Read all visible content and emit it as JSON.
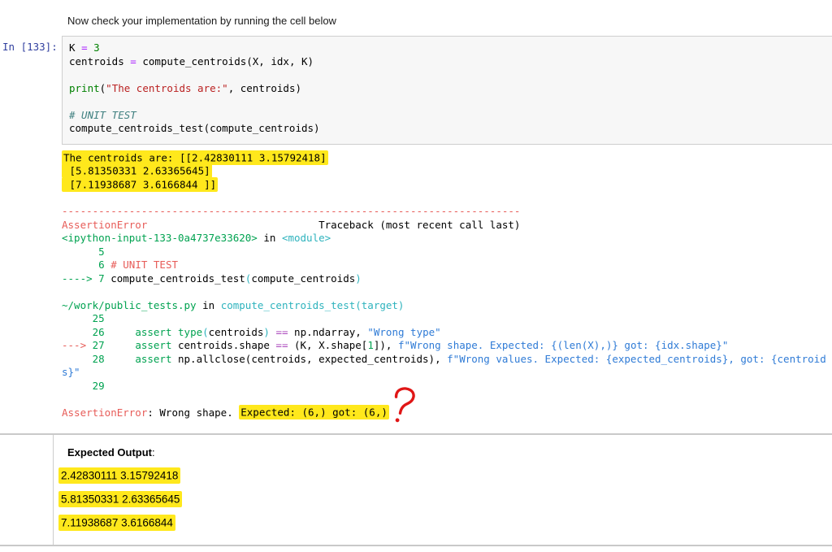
{
  "page": {
    "intro_text": "Now check your implementation by running the cell below"
  },
  "cell": {
    "prompt": "In [133]:",
    "code_lines": [
      {
        "segments": [
          {
            "t": "K "
          },
          {
            "t": "=",
            "c": "op"
          },
          {
            "t": " "
          },
          {
            "t": "3",
            "c": "num"
          }
        ]
      },
      {
        "segments": [
          {
            "t": "centroids "
          },
          {
            "t": "=",
            "c": "op"
          },
          {
            "t": " compute_centroids(X, idx, K)"
          }
        ]
      },
      {
        "segments": []
      },
      {
        "segments": [
          {
            "t": "print",
            "c": "bi"
          },
          {
            "t": "("
          },
          {
            "t": "\"The centroids are:\"",
            "c": "str"
          },
          {
            "t": ", centroids)"
          }
        ]
      },
      {
        "segments": []
      },
      {
        "segments": [
          {
            "t": "# UNIT TEST",
            "c": "cm"
          }
        ]
      },
      {
        "segments": [
          {
            "t": "compute_centroids_test(compute_centroids)"
          }
        ]
      }
    ]
  },
  "output": {
    "stdout_lines": [
      {
        "segments": [
          {
            "t": "The centroids are: [[2.42830111 3.15792418]",
            "h": true
          }
        ]
      },
      {
        "segments": [
          {
            "t": " [5.81350331 2.63365645]",
            "h": true
          }
        ]
      },
      {
        "segments": [
          {
            "t": " [7.11938687 3.6166844 ]]",
            "h": true
          }
        ]
      }
    ],
    "traceback_lines": [
      {
        "segments": [
          {
            "t": "---------------------------------------------------------------------------",
            "c": "r"
          }
        ]
      },
      {
        "segments": [
          {
            "t": "AssertionError",
            "c": "r"
          },
          {
            "t": "                            Traceback (most recent call last)"
          }
        ]
      },
      {
        "segments": [
          {
            "t": "<ipython-input-133-0a4737e33620>",
            "c": "g"
          },
          {
            "t": " in "
          },
          {
            "t": "<module>",
            "c": "cy"
          }
        ]
      },
      {
        "segments": [
          {
            "t": "      5 ",
            "c": "g"
          }
        ]
      },
      {
        "segments": [
          {
            "t": "      6 ",
            "c": "g"
          },
          {
            "t": "# UNIT TEST",
            "c": "r"
          }
        ]
      },
      {
        "segments": [
          {
            "t": "----> 7 ",
            "c": "g"
          },
          {
            "t": "compute_centroids_test"
          },
          {
            "t": "(",
            "c": "cy"
          },
          {
            "t": "compute_centroids"
          },
          {
            "t": ")",
            "c": "cy"
          }
        ]
      },
      {
        "segments": []
      },
      {
        "segments": [
          {
            "t": "~/work/public_tests.py",
            "c": "g"
          },
          {
            "t": " in "
          },
          {
            "t": "compute_centroids_test(target)",
            "c": "cy"
          }
        ]
      },
      {
        "segments": [
          {
            "t": "     25 ",
            "c": "g"
          }
        ]
      },
      {
        "segments": [
          {
            "t": "     26 ",
            "c": "g"
          },
          {
            "t": "    "
          },
          {
            "t": "assert",
            "c": "g"
          },
          {
            "t": " "
          },
          {
            "t": "type",
            "c": "g"
          },
          {
            "t": "(",
            "c": "cy"
          },
          {
            "t": "centroids"
          },
          {
            "t": ")",
            "c": "cy"
          },
          {
            "t": " "
          },
          {
            "t": "==",
            "c": "pu"
          },
          {
            "t": " np.ndarray, "
          },
          {
            "t": "\"Wrong type\"",
            "c": "bl"
          }
        ]
      },
      {
        "segments": [
          {
            "t": "---> ",
            "c": "r"
          },
          {
            "t": "27 ",
            "c": "g"
          },
          {
            "t": "    "
          },
          {
            "t": "assert",
            "c": "g"
          },
          {
            "t": " centroids.shape "
          },
          {
            "t": "==",
            "c": "pu"
          },
          {
            "t": " (K, X.shape["
          },
          {
            "t": "1",
            "c": "g"
          },
          {
            "t": "]), "
          },
          {
            "t": "f\"Wrong shape. Expected: {(len(X),)} got: {idx.shape}\"",
            "c": "bl"
          }
        ]
      },
      {
        "segments": [
          {
            "t": "     28 ",
            "c": "g"
          },
          {
            "t": "    "
          },
          {
            "t": "assert",
            "c": "g"
          },
          {
            "t": " np.allclose(centroids, expected_centroids), "
          },
          {
            "t": "f\"Wrong values. Expected: {expected_centroids}, got: {centroid",
            "c": "bl"
          }
        ]
      },
      {
        "segments": [
          {
            "t": "s}\"",
            "c": "bl"
          }
        ]
      },
      {
        "segments": [
          {
            "t": "     29 ",
            "c": "g"
          }
        ]
      },
      {
        "segments": []
      },
      {
        "segments": [
          {
            "t": "AssertionError",
            "c": "r"
          },
          {
            "t": ": Wrong shape. "
          },
          {
            "t": "Expected: (6,) got: (6,)",
            "h": true
          }
        ]
      }
    ]
  },
  "annotations": {
    "question_mark_glyph": "?",
    "question_mark_color": "#e01616",
    "highlight_color": "#ffe81c"
  },
  "expected_output": {
    "title": "Expected Output",
    "title_suffix": ":",
    "values": [
      "2.42830111 3.15792418",
      "5.81350331 2.63365645",
      "7.11938687 3.6166844"
    ]
  },
  "colors": {
    "prompt": "#303F9F",
    "cell_background": "#f7f7f7",
    "cell_border": "#cfcfcf",
    "ansi_red": "#e75c58",
    "ansi_green": "#00a250",
    "ansi_cyan": "#2eb3bd",
    "ansi_blue": "#2f7bd6",
    "ansi_purple": "#ab47bc",
    "code_operator": "#AA22FF",
    "code_number": "#008000",
    "code_builtin": "#008000",
    "code_string": "#BA2121",
    "code_comment": "#408080",
    "divider": "#c9c9c9"
  }
}
